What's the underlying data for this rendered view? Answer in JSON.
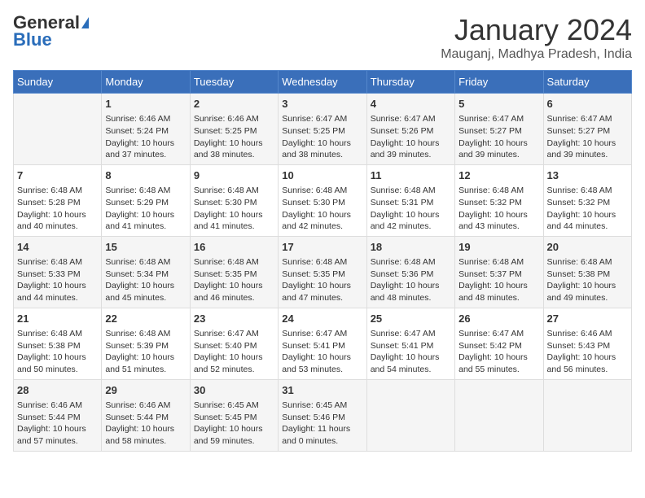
{
  "logo": {
    "general": "General",
    "blue": "Blue"
  },
  "title": "January 2024",
  "subtitle": "Mauganj, Madhya Pradesh, India",
  "days_header": [
    "Sunday",
    "Monday",
    "Tuesday",
    "Wednesday",
    "Thursday",
    "Friday",
    "Saturday"
  ],
  "weeks": [
    [
      {
        "day": "",
        "info": ""
      },
      {
        "day": "1",
        "info": "Sunrise: 6:46 AM\nSunset: 5:24 PM\nDaylight: 10 hours\nand 37 minutes."
      },
      {
        "day": "2",
        "info": "Sunrise: 6:46 AM\nSunset: 5:25 PM\nDaylight: 10 hours\nand 38 minutes."
      },
      {
        "day": "3",
        "info": "Sunrise: 6:47 AM\nSunset: 5:25 PM\nDaylight: 10 hours\nand 38 minutes."
      },
      {
        "day": "4",
        "info": "Sunrise: 6:47 AM\nSunset: 5:26 PM\nDaylight: 10 hours\nand 39 minutes."
      },
      {
        "day": "5",
        "info": "Sunrise: 6:47 AM\nSunset: 5:27 PM\nDaylight: 10 hours\nand 39 minutes."
      },
      {
        "day": "6",
        "info": "Sunrise: 6:47 AM\nSunset: 5:27 PM\nDaylight: 10 hours\nand 39 minutes."
      }
    ],
    [
      {
        "day": "7",
        "info": "Sunrise: 6:48 AM\nSunset: 5:28 PM\nDaylight: 10 hours\nand 40 minutes."
      },
      {
        "day": "8",
        "info": "Sunrise: 6:48 AM\nSunset: 5:29 PM\nDaylight: 10 hours\nand 41 minutes."
      },
      {
        "day": "9",
        "info": "Sunrise: 6:48 AM\nSunset: 5:30 PM\nDaylight: 10 hours\nand 41 minutes."
      },
      {
        "day": "10",
        "info": "Sunrise: 6:48 AM\nSunset: 5:30 PM\nDaylight: 10 hours\nand 42 minutes."
      },
      {
        "day": "11",
        "info": "Sunrise: 6:48 AM\nSunset: 5:31 PM\nDaylight: 10 hours\nand 42 minutes."
      },
      {
        "day": "12",
        "info": "Sunrise: 6:48 AM\nSunset: 5:32 PM\nDaylight: 10 hours\nand 43 minutes."
      },
      {
        "day": "13",
        "info": "Sunrise: 6:48 AM\nSunset: 5:32 PM\nDaylight: 10 hours\nand 44 minutes."
      }
    ],
    [
      {
        "day": "14",
        "info": "Sunrise: 6:48 AM\nSunset: 5:33 PM\nDaylight: 10 hours\nand 44 minutes."
      },
      {
        "day": "15",
        "info": "Sunrise: 6:48 AM\nSunset: 5:34 PM\nDaylight: 10 hours\nand 45 minutes."
      },
      {
        "day": "16",
        "info": "Sunrise: 6:48 AM\nSunset: 5:35 PM\nDaylight: 10 hours\nand 46 minutes."
      },
      {
        "day": "17",
        "info": "Sunrise: 6:48 AM\nSunset: 5:35 PM\nDaylight: 10 hours\nand 47 minutes."
      },
      {
        "day": "18",
        "info": "Sunrise: 6:48 AM\nSunset: 5:36 PM\nDaylight: 10 hours\nand 48 minutes."
      },
      {
        "day": "19",
        "info": "Sunrise: 6:48 AM\nSunset: 5:37 PM\nDaylight: 10 hours\nand 48 minutes."
      },
      {
        "day": "20",
        "info": "Sunrise: 6:48 AM\nSunset: 5:38 PM\nDaylight: 10 hours\nand 49 minutes."
      }
    ],
    [
      {
        "day": "21",
        "info": "Sunrise: 6:48 AM\nSunset: 5:38 PM\nDaylight: 10 hours\nand 50 minutes."
      },
      {
        "day": "22",
        "info": "Sunrise: 6:48 AM\nSunset: 5:39 PM\nDaylight: 10 hours\nand 51 minutes."
      },
      {
        "day": "23",
        "info": "Sunrise: 6:47 AM\nSunset: 5:40 PM\nDaylight: 10 hours\nand 52 minutes."
      },
      {
        "day": "24",
        "info": "Sunrise: 6:47 AM\nSunset: 5:41 PM\nDaylight: 10 hours\nand 53 minutes."
      },
      {
        "day": "25",
        "info": "Sunrise: 6:47 AM\nSunset: 5:41 PM\nDaylight: 10 hours\nand 54 minutes."
      },
      {
        "day": "26",
        "info": "Sunrise: 6:47 AM\nSunset: 5:42 PM\nDaylight: 10 hours\nand 55 minutes."
      },
      {
        "day": "27",
        "info": "Sunrise: 6:46 AM\nSunset: 5:43 PM\nDaylight: 10 hours\nand 56 minutes."
      }
    ],
    [
      {
        "day": "28",
        "info": "Sunrise: 6:46 AM\nSunset: 5:44 PM\nDaylight: 10 hours\nand 57 minutes."
      },
      {
        "day": "29",
        "info": "Sunrise: 6:46 AM\nSunset: 5:44 PM\nDaylight: 10 hours\nand 58 minutes."
      },
      {
        "day": "30",
        "info": "Sunrise: 6:45 AM\nSunset: 5:45 PM\nDaylight: 10 hours\nand 59 minutes."
      },
      {
        "day": "31",
        "info": "Sunrise: 6:45 AM\nSunset: 5:46 PM\nDaylight: 11 hours\nand 0 minutes."
      },
      {
        "day": "",
        "info": ""
      },
      {
        "day": "",
        "info": ""
      },
      {
        "day": "",
        "info": ""
      }
    ]
  ]
}
